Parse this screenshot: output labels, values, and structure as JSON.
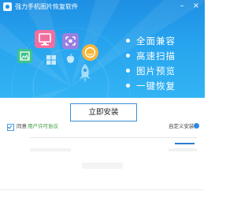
{
  "app": {
    "title": "强力手机图片恢复软件"
  },
  "window_controls": {
    "minimize": "–",
    "close": "×"
  },
  "features": [
    {
      "label": "全面兼容"
    },
    {
      "label": "高速扫描"
    },
    {
      "label": "图片预览"
    },
    {
      "label": "一键恢复"
    }
  ],
  "install": {
    "label": "立即安装"
  },
  "agreement": {
    "agree_text": "同意",
    "license_text": "用户许可协议",
    "checked": true
  },
  "options": {
    "custom_install": "自定义安装"
  },
  "colors": {
    "header_top": "#1e8fe3",
    "header_bottom": "#33b4f4",
    "button_border": "#3a8fd6",
    "link_green": "#3a9a3a",
    "accent_blue": "#2a7ed0"
  },
  "icons": {
    "header_tiles": [
      "monitor-icon",
      "crop-icon",
      "photo-icon",
      "smile-icon",
      "windows-icon",
      "apple-icon",
      "rocket-icon"
    ]
  }
}
